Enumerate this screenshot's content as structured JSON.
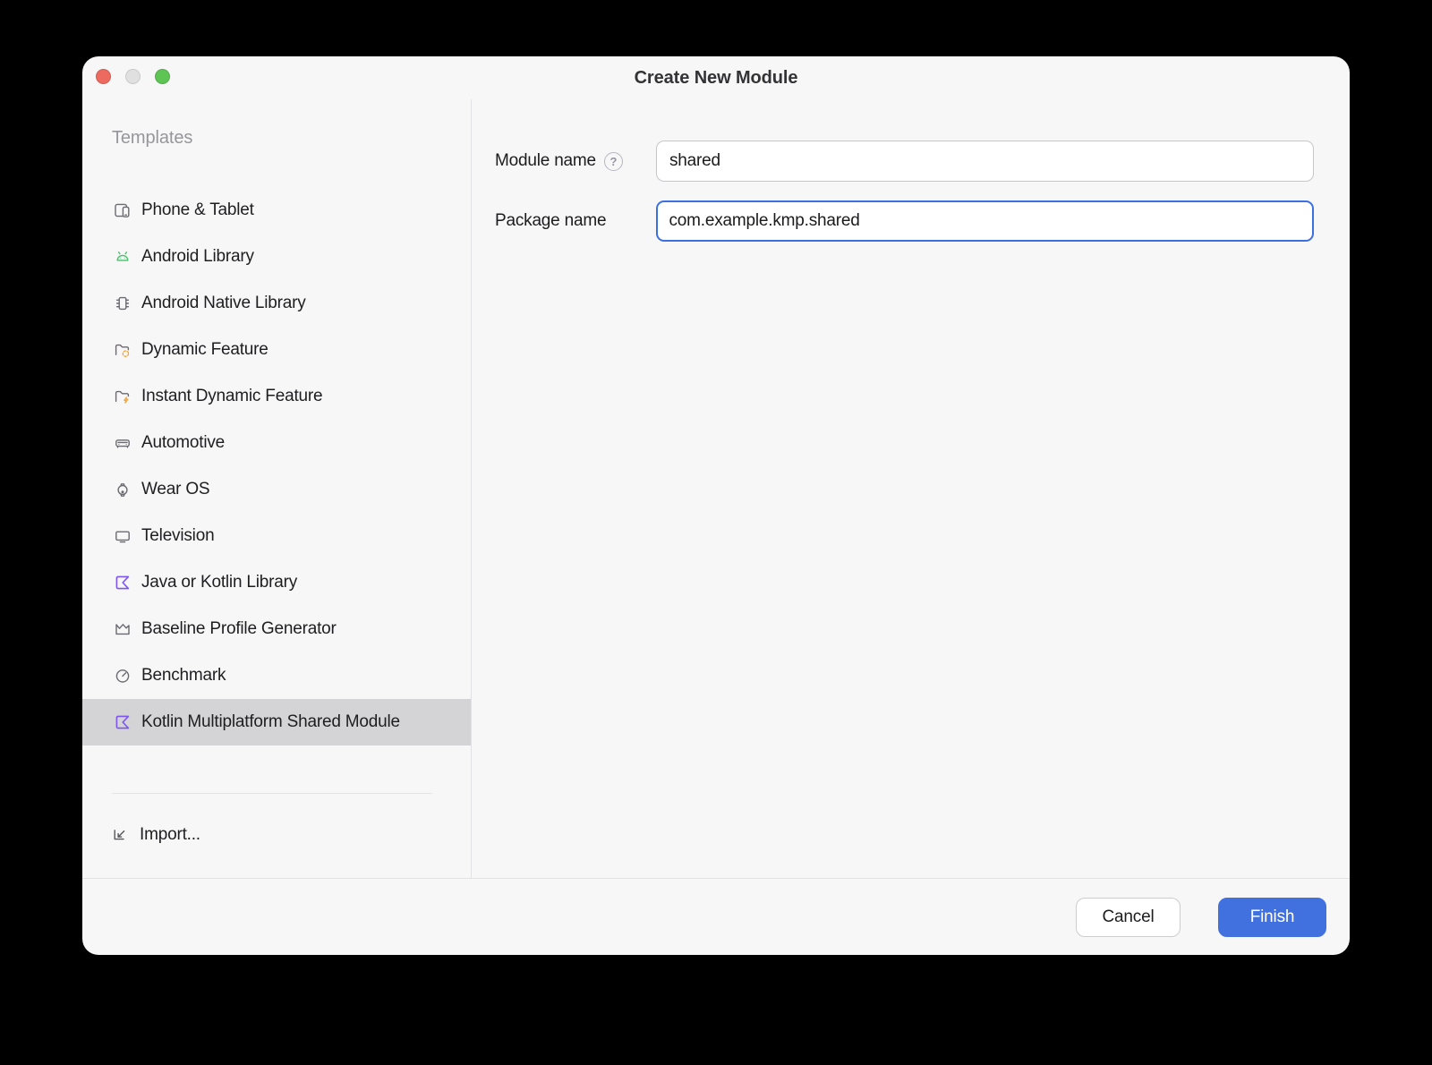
{
  "window": {
    "title": "Create New Module"
  },
  "traffic_lights": {
    "close": "#ec6a5e",
    "minimize": "#e0e0e0",
    "zoom": "#5ec454"
  },
  "sidebar": {
    "heading": "Templates",
    "items": [
      {
        "label": "Phone & Tablet",
        "icon": "phone-tablet-icon",
        "selected": false
      },
      {
        "label": "Android Library",
        "icon": "android-icon",
        "selected": false
      },
      {
        "label": "Android Native Library",
        "icon": "chip-icon",
        "selected": false
      },
      {
        "label": "Dynamic Feature",
        "icon": "folder-dynamic-icon",
        "selected": false
      },
      {
        "label": "Instant Dynamic Feature",
        "icon": "folder-bolt-icon",
        "selected": false
      },
      {
        "label": "Automotive",
        "icon": "car-icon",
        "selected": false
      },
      {
        "label": "Wear OS",
        "icon": "watch-icon",
        "selected": false
      },
      {
        "label": "Television",
        "icon": "tv-icon",
        "selected": false
      },
      {
        "label": "Java or Kotlin Library",
        "icon": "kotlin-icon",
        "selected": false
      },
      {
        "label": "Baseline Profile Generator",
        "icon": "chart-icon",
        "selected": false
      },
      {
        "label": "Benchmark",
        "icon": "gauge-icon",
        "selected": false
      },
      {
        "label": "Kotlin Multiplatform Shared Module",
        "icon": "kotlin-icon",
        "selected": true
      }
    ],
    "import_label": "Import..."
  },
  "form": {
    "fields": [
      {
        "label": "Module name",
        "value": "shared",
        "has_help": true,
        "focused": false
      },
      {
        "label": "Package name",
        "value": "com.example.kmp.shared",
        "has_help": false,
        "focused": true
      }
    ]
  },
  "footer": {
    "cancel_label": "Cancel",
    "finish_label": "Finish"
  },
  "colors": {
    "accent_blue": "#4170df",
    "focus_border": "#3c70e1",
    "android_green": "#49c06d",
    "kotlin_purple": "#7d55f3",
    "folder_orange": "#f0a63c",
    "selected_row": "#d4d4d6",
    "window_bg": "#f7f7f8"
  }
}
